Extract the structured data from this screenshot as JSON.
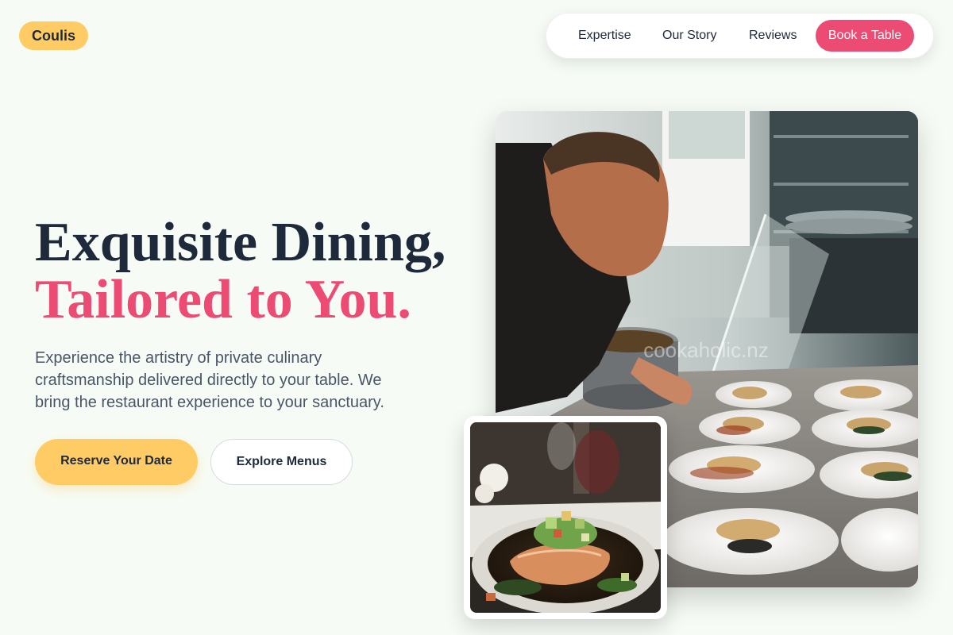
{
  "brand": {
    "name": "Coulis"
  },
  "nav": {
    "links": [
      "Expertise",
      "Our Story",
      "Reviews"
    ],
    "cta": "Book a Table"
  },
  "hero": {
    "headline_line1": "Exquisite Dining,",
    "headline_line2": "Tailored to You.",
    "description": "Experience the artistry of private culinary craftsmanship delivered directly to your table. We bring the restaurant experience to your sanctuary.",
    "primary_button": "Reserve Your Date",
    "secondary_button": "Explore Menus"
  },
  "images": {
    "main_watermark": "cookaholic.nz"
  },
  "colors": {
    "background": "#f6fcf5",
    "accent_pink": "#ec4c74",
    "accent_yellow": "#ffcb64",
    "text_dark": "#1e293b",
    "text_muted": "#4a5568"
  }
}
